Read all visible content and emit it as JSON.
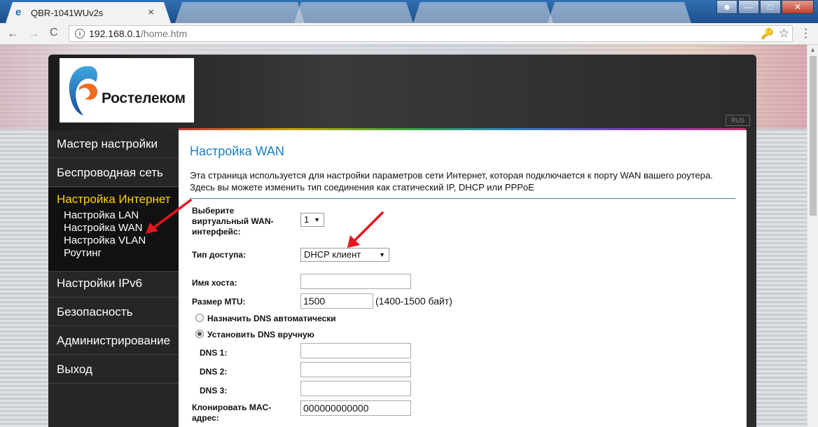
{
  "browser": {
    "tab_active_title": "QBR-1041WUv2s",
    "tab_close": "×",
    "url_host": "192.168.0.1",
    "url_path": "/home.htm",
    "back": "←",
    "forward": "→",
    "reload": "C",
    "key": "🔑",
    "star": "☆",
    "menu": "⋮",
    "win_min": "—",
    "win_max": "□",
    "win_close": "✕"
  },
  "header": {
    "logo_text": "Ростелеком",
    "lang": "RUS"
  },
  "sidebar": {
    "items": [
      {
        "label": "Мастер настройки"
      },
      {
        "label": "Беспроводная сеть"
      },
      {
        "label": "Настройка Интернет",
        "active": true,
        "children": [
          "Настройка LAN",
          "Настройка WAN",
          "Настройка VLAN",
          "Роутинг"
        ]
      },
      {
        "label": "Настройки IPv6"
      },
      {
        "label": "Безопасность"
      },
      {
        "label": "Администрирование"
      },
      {
        "label": "Выход"
      }
    ]
  },
  "content": {
    "title": "Настройка WAN",
    "description": "Эта страница используется для настройки параметров сети Интернет, которая подключается к порту WAN вашего роутера. Здесь вы можете изменить тип соединения как статический IP, DHCP или PPPoE",
    "form": {
      "wan_interface_label": "Выберите виртуальный WAN-интерфейс:",
      "wan_interface_value": "1",
      "access_type_label": "Тип доступа:",
      "access_type_value": "DHCP клиент",
      "hostname_label": "Имя хоста:",
      "hostname_value": "",
      "mtu_label": "Размер MTU:",
      "mtu_value": "1500",
      "mtu_hint": "(1400-1500 байт)",
      "dns_auto_label": "Назначить DNS автоматически",
      "dns_manual_label": "Установить DNS вручную",
      "dns_mode": "manual",
      "dns1_label": "DNS 1:",
      "dns2_label": "DNS 2:",
      "dns3_label": "DNS 3:",
      "dns1_value": "",
      "dns2_value": "",
      "dns3_value": "",
      "mac_label": "Клонировать MAC-адрес:",
      "mac_value": "000000000000"
    }
  },
  "colors": {
    "annotation_arrow": "#e8141c",
    "active_menu": "#ffd400",
    "title_blue": "#1b7fc3"
  }
}
